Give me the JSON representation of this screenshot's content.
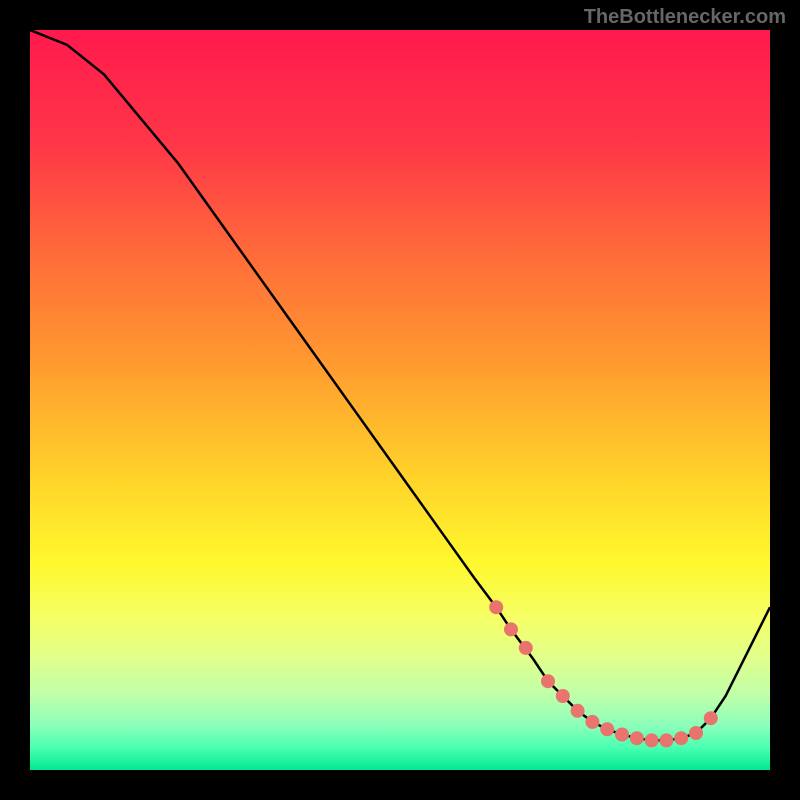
{
  "watermark": "TheBottlenecker.com",
  "chart_data": {
    "type": "line",
    "title": "",
    "xlabel": "",
    "ylabel": "",
    "xlim": [
      0,
      100
    ],
    "ylim": [
      0,
      100
    ],
    "series": [
      {
        "name": "bottleneck-curve",
        "x": [
          0,
          5,
          10,
          15,
          20,
          25,
          30,
          35,
          40,
          45,
          50,
          55,
          60,
          63,
          65,
          68,
          70,
          72,
          74,
          76,
          78,
          80,
          82,
          84,
          86,
          88,
          90,
          92,
          94,
          96,
          98,
          100
        ],
        "y": [
          100,
          98,
          94,
          88,
          82,
          75,
          68,
          61,
          54,
          47,
          40,
          33,
          26,
          22,
          19,
          15,
          12,
          10,
          8,
          6.5,
          5.5,
          4.8,
          4.3,
          4.0,
          4.0,
          4.3,
          5.0,
          7.0,
          10,
          14,
          18,
          22
        ]
      }
    ],
    "markers": {
      "name": "highlight-dots",
      "x_percent": [
        63,
        65,
        67,
        70,
        72,
        74,
        76,
        78,
        80,
        82,
        84,
        86,
        88,
        90,
        92
      ],
      "y_percent": [
        22,
        19,
        16.5,
        12,
        10,
        8,
        6.5,
        5.5,
        4.8,
        4.3,
        4.0,
        4.0,
        4.3,
        5.0,
        7.0
      ],
      "color": "#e8746d"
    },
    "background_gradient_stops": [
      {
        "offset": 0,
        "color": "#ff1a4d"
      },
      {
        "offset": 15,
        "color": "#ff3548"
      },
      {
        "offset": 30,
        "color": "#ff6a3a"
      },
      {
        "offset": 45,
        "color": "#ff9a2f"
      },
      {
        "offset": 60,
        "color": "#ffd12a"
      },
      {
        "offset": 72,
        "color": "#fff82d"
      },
      {
        "offset": 80,
        "color": "#f4ff6a"
      },
      {
        "offset": 85,
        "color": "#e0ff8c"
      },
      {
        "offset": 90,
        "color": "#beffaa"
      },
      {
        "offset": 94,
        "color": "#8affba"
      },
      {
        "offset": 97,
        "color": "#4affb0"
      },
      {
        "offset": 100,
        "color": "#00e893"
      }
    ]
  }
}
